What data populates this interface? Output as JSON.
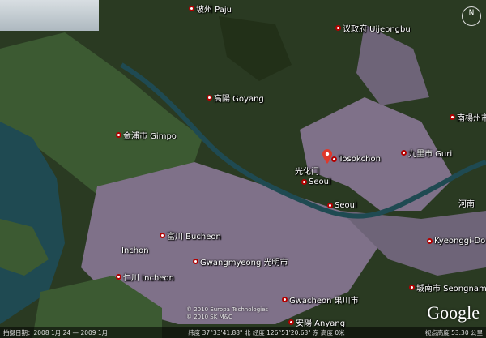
{
  "places": [
    {
      "id": "paju",
      "label": "坡州 Paju"
    },
    {
      "id": "uijeongbu",
      "label": "议政府 Uijeongbu"
    },
    {
      "id": "goyang",
      "label": "高陽 Goyang"
    },
    {
      "id": "gimpo",
      "label": "金浦市 Gimpo"
    },
    {
      "id": "namyangju",
      "label": "南楊州市"
    },
    {
      "id": "tosokchon",
      "label": "Tosokchon"
    },
    {
      "id": "gwanghwa",
      "label": "光化门"
    },
    {
      "id": "seoul_cn",
      "label": "Seoul"
    },
    {
      "id": "seoul",
      "label": "Seoul"
    },
    {
      "id": "guri",
      "label": "九里市 Guri"
    },
    {
      "id": "hanam",
      "label": "河南"
    },
    {
      "id": "bucheon",
      "label": "富川 Bucheon"
    },
    {
      "id": "incheon_en",
      "label": "Inchon"
    },
    {
      "id": "incheon",
      "label": "仁川 Incheon"
    },
    {
      "id": "gwangmyeong",
      "label": "Gwangmyeong 光明市"
    },
    {
      "id": "gyeonggi",
      "label": "Kyeonggi-Do"
    },
    {
      "id": "seongnam",
      "label": "城南市 Seongnam"
    },
    {
      "id": "gwacheon",
      "label": "Gwacheon 果川市"
    },
    {
      "id": "anyang",
      "label": "安陽 Anyang"
    }
  ],
  "status_bar": {
    "left": "拍摄日期：2008 1月 24 — 2009 1月",
    "middle": "纬度 37°33'41.88\" 北  经度 126°51'20.63\" 东   高度 0米",
    "right": "视点高度 53.30 公里"
  },
  "copyright": [
    "© 2010 Europa Technologies",
    "© 2010 SK M&C"
  ],
  "logo": "Google",
  "compass": {
    "label": "N"
  },
  "colors": {
    "water": "#1f4a52",
    "urban": "#7f7189",
    "forest": "#2a3a22",
    "farmland": "#3c5a32",
    "pin": "#e0382b"
  },
  "icons": [
    "placemark-pin-icon",
    "compass-icon",
    "place-dot-icon"
  ]
}
